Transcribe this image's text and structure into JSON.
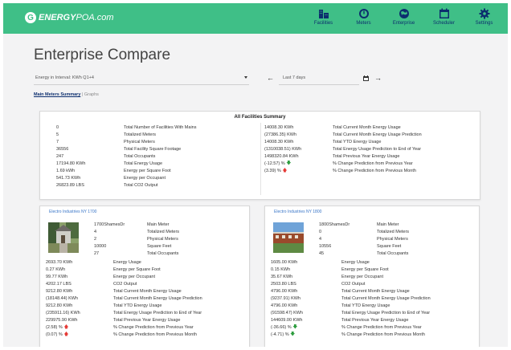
{
  "header": {
    "logo_bold": "ENERGY",
    "logo_rest": "POA.com",
    "nav": [
      {
        "label": "Facilities",
        "icon": "facilities-icon"
      },
      {
        "label": "Meters",
        "icon": "meter-gauge-icon"
      },
      {
        "label": "Enterprise",
        "icon": "globe-icon"
      },
      {
        "label": "Scheduler",
        "icon": "calendar-icon"
      },
      {
        "label": "Settings",
        "icon": "gear-icon"
      }
    ]
  },
  "page": {
    "title": "Enterprise Compare"
  },
  "controls": {
    "energy_select": "Energy in Interval: KWh Q1+4",
    "date_range": "Last 7 days",
    "prev_arrow": "←",
    "next_arrow": "→"
  },
  "tabs": {
    "active": "Main Meters Summary",
    "separator": " | ",
    "other": "Graphs"
  },
  "summary": {
    "title": "All Facilities Summary",
    "left": [
      {
        "value": "0",
        "label": "Total Number of Facilities With Mains"
      },
      {
        "value": "5",
        "label": "Totalized Meters"
      },
      {
        "value": "7",
        "label": "Physical Meters"
      },
      {
        "value": "36556",
        "label": "Total Facility Square Footage"
      },
      {
        "value": "247",
        "label": "Total Occupants"
      },
      {
        "value": "17194.80 KWh",
        "label": "Total Energy Usage"
      },
      {
        "value": "1.69 kWh",
        "label": "Energy per Square Foot"
      },
      {
        "value": "541.73 KWh",
        "label": "Energy per Occupant"
      },
      {
        "value": "26823.89 LBS",
        "label": "Total CO2 Output"
      }
    ],
    "right": [
      {
        "value": "14008.30 KWh",
        "label": "Total Current Month Energy Usage",
        "trend": ""
      },
      {
        "value": "(27386.35) KWh",
        "label": "Total Current Month Energy Usage Prediction",
        "trend": ""
      },
      {
        "value": "14008.30 KWh",
        "label": "Total YTD Energy Usage",
        "trend": ""
      },
      {
        "value": "(1310038.51) KWh",
        "label": "Total Energy Usage Prediction to End of Year",
        "trend": ""
      },
      {
        "value": "1498320.84 KWh",
        "label": "Total Previous Year Energy Usage",
        "trend": ""
      },
      {
        "value": "(-12.57) %",
        "label": "% Change Prediction from Previous Year",
        "trend": "down"
      },
      {
        "value": "(3.39) %",
        "label": "% Change Prediction from Previous Month",
        "trend": "up"
      }
    ]
  },
  "facilities": [
    {
      "name": "Electro Industries NY 1700",
      "address": "1700ShamesDr",
      "meta": [
        {
          "value": "",
          "label": "Main Meter"
        },
        {
          "value": "4",
          "label": "Totalized Meters"
        },
        {
          "value": "2",
          "label": "Physical Meters"
        },
        {
          "value": "10000",
          "label": "Square Feet"
        },
        {
          "value": "27",
          "label": "Total Occupants"
        }
      ],
      "stats": [
        {
          "value": "2693.70 KWh",
          "label": "Energy Usage",
          "trend": ""
        },
        {
          "value": "0.27 KWh",
          "label": "Energy per Square Foot",
          "trend": ""
        },
        {
          "value": "99.77 KWh",
          "label": "Energy per Occupant",
          "trend": ""
        },
        {
          "value": "4202.17 LBS",
          "label": "CO2 Output",
          "trend": ""
        },
        {
          "value": "9212.80 KWh",
          "label": "Total Current Month Energy Usage",
          "trend": ""
        },
        {
          "value": "(18148.44) KWh",
          "label": "Total Current Month Energy Usage Prediction",
          "trend": ""
        },
        {
          "value": "9212.80 KWh",
          "label": "Total YTD Energy Usage",
          "trend": ""
        },
        {
          "value": "(235911.16) KWh",
          "label": "Total Energy Usage Prediction to End of Year",
          "trend": ""
        },
        {
          "value": "229975.90 KWh",
          "label": "Total Previous Year Energy Usage",
          "trend": ""
        },
        {
          "value": "(2.58) %",
          "label": "% Change Prediction from Previous Year",
          "trend": "up"
        },
        {
          "value": "(0.07) %",
          "label": "% Change Prediction from Previous Month",
          "trend": "up"
        }
      ]
    },
    {
      "name": "Electro Industries NY 1800",
      "address": "1800ShamesDr",
      "meta": [
        {
          "value": "",
          "label": "Main Meter"
        },
        {
          "value": "0",
          "label": "Totalized Meters"
        },
        {
          "value": "4",
          "label": "Physical Meters"
        },
        {
          "value": "10556",
          "label": "Square Feet"
        },
        {
          "value": "45",
          "label": "Total Occupants"
        }
      ],
      "stats": [
        {
          "value": "1605.00 KWh",
          "label": "Energy Usage",
          "trend": ""
        },
        {
          "value": "0.15 KWh",
          "label": "Energy per Square Foot",
          "trend": ""
        },
        {
          "value": "35.67 KWh",
          "label": "Energy per Occupant",
          "trend": ""
        },
        {
          "value": "2503.80 LBS",
          "label": "CO2 Output",
          "trend": ""
        },
        {
          "value": "4796.00 KWh",
          "label": "Total Current Month Energy Usage",
          "trend": ""
        },
        {
          "value": "(9237.91) KWh",
          "label": "Total Current Month Energy Usage Prediction",
          "trend": ""
        },
        {
          "value": "4796.00 KWh",
          "label": "Total YTD Energy Usage",
          "trend": ""
        },
        {
          "value": "(91598.47) KWh",
          "label": "Total Energy Usage Prediction to End of Year",
          "trend": ""
        },
        {
          "value": "144609.00 KWh",
          "label": "Total Previous Year Energy Usage",
          "trend": ""
        },
        {
          "value": "(-36.66) %",
          "label": "% Change Prediction from Previous Year",
          "trend": "down"
        },
        {
          "value": "(-4.71) %",
          "label": "% Change Prediction from Previous Month",
          "trend": "down"
        }
      ]
    }
  ],
  "colors": {
    "header_green": "#3fbf87",
    "nav_blue": "#0c2e6e",
    "link_blue": "#3a76c8",
    "up_red": "#e53935",
    "down_green": "#2e9d3f"
  }
}
